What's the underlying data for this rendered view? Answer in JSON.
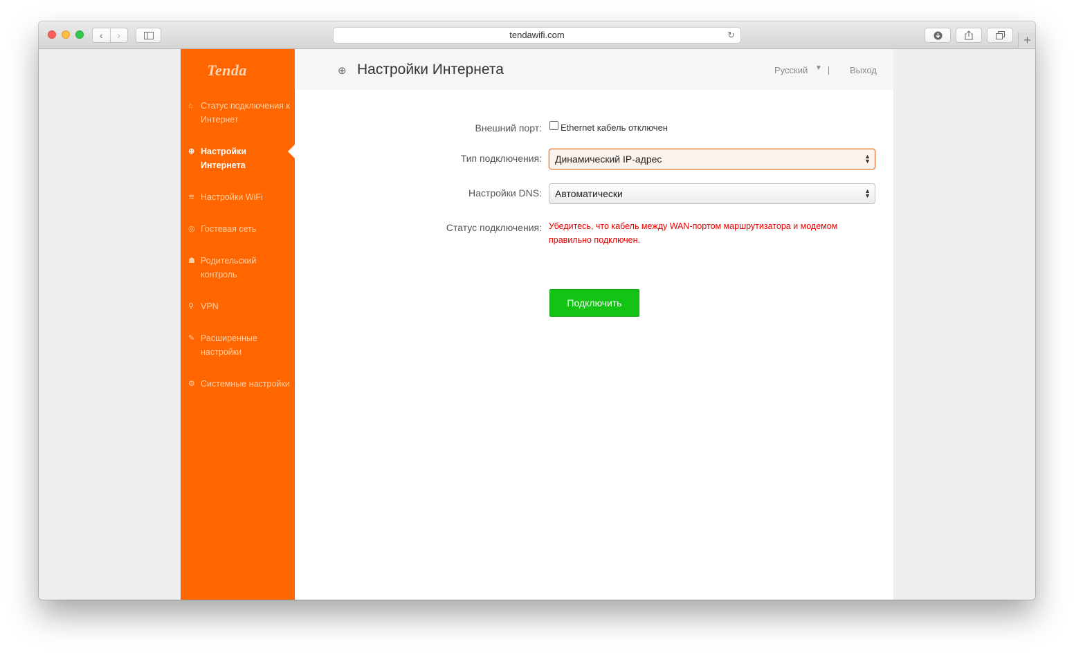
{
  "browser": {
    "url": "tendawifi.com"
  },
  "sidebar": {
    "logo": "Tenda",
    "items": [
      {
        "label": "Статус подключения к Интернет",
        "icon": "router-icon",
        "active": false
      },
      {
        "label": "Настройки Интернета",
        "icon": "globe-icon",
        "active": true
      },
      {
        "label": "Настройки WiFi",
        "icon": "wifi-icon",
        "active": false
      },
      {
        "label": "Гостевая сеть",
        "icon": "guest-icon",
        "active": false
      },
      {
        "label": "Родительский контроль",
        "icon": "parental-icon",
        "active": false
      },
      {
        "label": "VPN",
        "icon": "vpn-icon",
        "active": false
      },
      {
        "label": "Расширенные настройки",
        "icon": "tools-icon",
        "active": false
      },
      {
        "label": "Системные настройки",
        "icon": "settings-icon",
        "active": false
      }
    ]
  },
  "header": {
    "title": "Настройки Интернета",
    "language": "Русский",
    "logout": "Выход"
  },
  "form": {
    "wan_port": {
      "label": "Внешний порт:",
      "checkbox_label": "Ethernet кабель отключен",
      "checked": false
    },
    "connection_type": {
      "label": "Тип подключения:",
      "value": "Динамический IP-адрес"
    },
    "dns": {
      "label": "Настройки DNS:",
      "value": "Автоматически"
    },
    "status": {
      "label": "Статус подключения:",
      "message": "Убедитесь, что кабель между WAN-портом маршрутизатора и модемом правильно подключен."
    },
    "connect_button": "Подключить"
  },
  "colors": {
    "brand": "#ff6600",
    "button": "#14c414",
    "error": "#e60000"
  }
}
